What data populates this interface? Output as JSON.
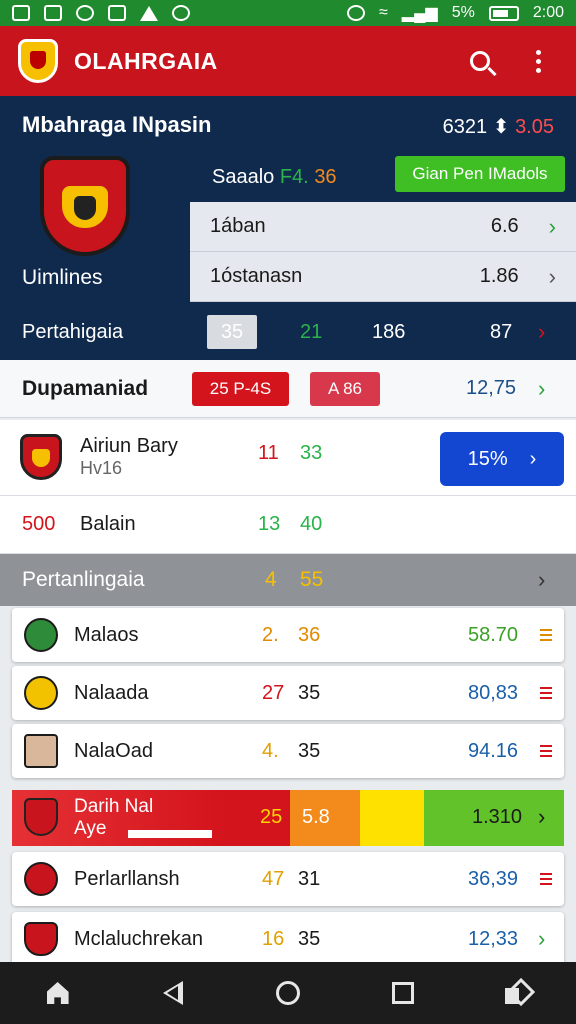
{
  "status_bar": {
    "battery": "5%",
    "time": "2:00"
  },
  "app_bar": {
    "title": "OLAHRGAIA"
  },
  "hero": {
    "title": "Mbahraga INpasin",
    "score_a": "6321",
    "score_sep": "⬍",
    "score_b": "3.05",
    "team_label": "Saaalo",
    "team_val_a": "F4.",
    "team_val_b": "36",
    "cta_label": "Gian Pen IMadols",
    "panel": [
      {
        "label": "1ában",
        "value": "6.6"
      },
      {
        "label": "1óstanasn",
        "value": "1.86"
      }
    ],
    "left_label": "Uimlines",
    "row": {
      "label": "Pertahigaia",
      "chip": "35",
      "v1": "21",
      "v2": "186",
      "v3": "87"
    }
  },
  "tabs_row": {
    "label": "Dupamaniad",
    "pill_1": "25 P-4S",
    "pill_2": "A 86",
    "value": "12,75"
  },
  "match_row": {
    "name": "Airiun Bary",
    "sub": "Hv16",
    "s1": "11",
    "s2": "33",
    "button": "15%"
  },
  "simple_row": {
    "num": "500",
    "label": "Balain",
    "v1": "13",
    "v2": "40"
  },
  "section_header": {
    "label": "Pertanlingaia",
    "v1": "4",
    "v2": "55"
  },
  "list": [
    {
      "label": "Malaos",
      "s1": "2.",
      "s2": "36",
      "value": "58.70",
      "s1_color": "#e08a00",
      "s2_color": "#e08a00",
      "value_color": "#3aa126",
      "menu_color": "#e08a00"
    },
    {
      "label": "Nalaada",
      "s1": "27",
      "s2": "35",
      "value": "80,83",
      "s1_color": "#d4141c",
      "s2_color": "#1a1a1a",
      "value_color": "#1b5fa8",
      "menu_color": "#d4141c"
    },
    {
      "label": "NalaOad",
      "s1": "4.",
      "s2": "35",
      "value": "94.16",
      "s1_color": "#e0a000",
      "s2_color": "#1a1a1a",
      "value_color": "#1b5fa8",
      "menu_color": "#d4141c"
    }
  ],
  "highlight_row": {
    "line1": "Darih Nal",
    "line2": "Aye",
    "s1": "25",
    "s2": "5.8",
    "value": "1.310"
  },
  "list2": [
    {
      "label": "Perlarllansh",
      "s1": "47",
      "s2": "31",
      "value": "36,39",
      "s1_color": "#e0a000",
      "value_color": "#1b5fa8",
      "menu_color": "#d4141c"
    },
    {
      "label": "Mclaluchrekan",
      "s1": "16",
      "s2": "35",
      "value": "12,33",
      "s1_color": "#e0a000",
      "value_color": "#1b5fa8",
      "menu_color": "#2aa03a"
    }
  ]
}
